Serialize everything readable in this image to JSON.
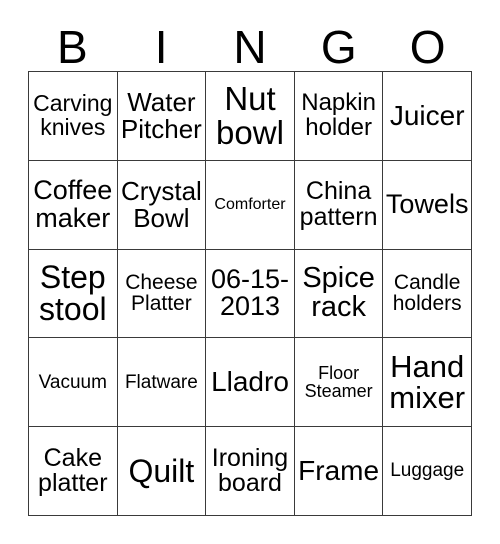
{
  "card": {
    "title": "BINGO",
    "header_letters": [
      "B",
      "I",
      "N",
      "G",
      "O"
    ],
    "columns": 5,
    "rows": 5,
    "grid_line_color": "#3a3a3a",
    "background_color": "#ffffff",
    "text_color": "#000000",
    "cells": [
      {
        "text": "Carving knives",
        "fontpx": 23
      },
      {
        "text": "Water Pitcher",
        "fontpx": 26
      },
      {
        "text": "Nut bowl",
        "fontpx": 33
      },
      {
        "text": "Napkin holder",
        "fontpx": 24
      },
      {
        "text": "Juicer",
        "fontpx": 28
      },
      {
        "text": "Coffee maker",
        "fontpx": 27
      },
      {
        "text": "Crystal Bowl",
        "fontpx": 26
      },
      {
        "text": "Comforter",
        "fontpx": 16
      },
      {
        "text": "China pattern",
        "fontpx": 25
      },
      {
        "text": "Towels",
        "fontpx": 27
      },
      {
        "text": "Step stool",
        "fontpx": 32
      },
      {
        "text": "Cheese Platter",
        "fontpx": 21
      },
      {
        "text": "06-15-2013",
        "fontpx": 27
      },
      {
        "text": "Spice rack",
        "fontpx": 29
      },
      {
        "text": "Candle holders",
        "fontpx": 21
      },
      {
        "text": "Vacuum",
        "fontpx": 19
      },
      {
        "text": "Flatware",
        "fontpx": 19
      },
      {
        "text": "Lladro",
        "fontpx": 28
      },
      {
        "text": "Floor Steamer",
        "fontpx": 18
      },
      {
        "text": "Hand mixer",
        "fontpx": 31
      },
      {
        "text": "Cake platter",
        "fontpx": 25
      },
      {
        "text": "Quilt",
        "fontpx": 32
      },
      {
        "text": "Ironing board",
        "fontpx": 25
      },
      {
        "text": "Frame",
        "fontpx": 28
      },
      {
        "text": "Luggage",
        "fontpx": 19
      }
    ]
  }
}
